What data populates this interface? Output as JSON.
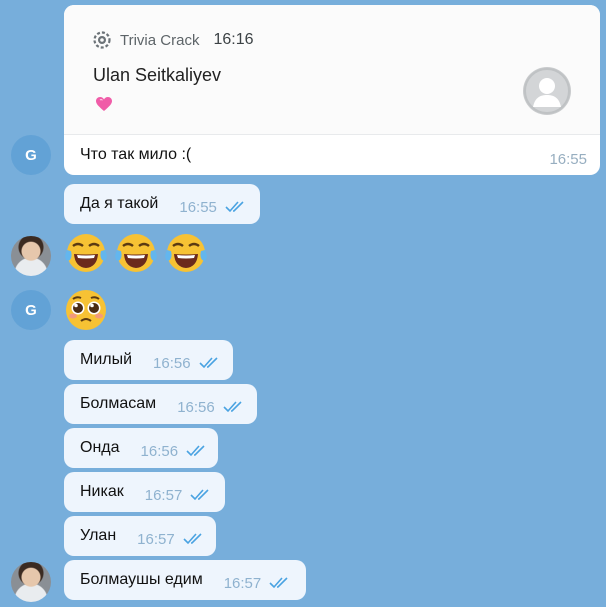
{
  "colors": {
    "chat_background": "#77aedb",
    "bubble": "#eef5fd",
    "avatar_letter_bg": "#62a2d6",
    "tick": "#4aa3e2",
    "time_text": "#8fb2cf"
  },
  "share_card": {
    "app_icon": "gear-icon",
    "app_name": "Trivia Crack",
    "app_time": "16:16",
    "user_name": "Ulan Seitkaliyev",
    "emoji": "pink-heart",
    "caption": "Что так мило :(",
    "time": "16:55"
  },
  "avatars": {
    "contact_letter": "G"
  },
  "messages": [
    {
      "text": "Да я такой",
      "time": "16:55",
      "read": true
    },
    {
      "emoji": "tears-of-joy x3"
    },
    {
      "emoji": "pleading-face"
    },
    {
      "text": "Милый",
      "time": "16:56",
      "read": true
    },
    {
      "text": "Болмасам",
      "time": "16:56",
      "read": true
    },
    {
      "text": "Онда",
      "time": "16:56",
      "read": true
    },
    {
      "text": "Никак",
      "time": "16:57",
      "read": true
    },
    {
      "text": "Улан",
      "time": "16:57",
      "read": true
    },
    {
      "text": "Болмаушы едим",
      "time": "16:57",
      "read": true
    }
  ]
}
